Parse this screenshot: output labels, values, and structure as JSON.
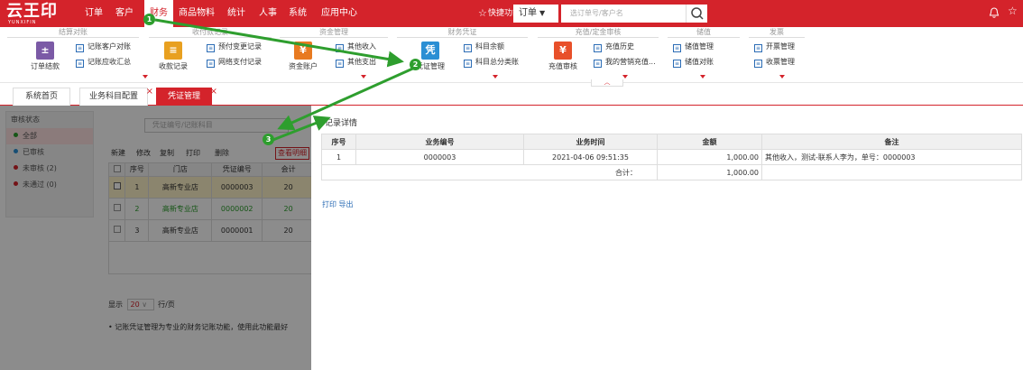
{
  "app": {
    "logo_text": "云王印",
    "logo_sub": "YUNXIFIN",
    "nav": [
      "订单",
      "客户",
      "财务",
      "商品物料",
      "统计",
      "人事",
      "系统",
      "应用中心"
    ],
    "quick": "快捷功能",
    "search_type": "订单",
    "search_placeholder": "选订单号/客户名"
  },
  "ribbon": {
    "groups": [
      "结算对账",
      "收付款记录",
      "资金管理",
      "财务凭证",
      "充值/定金审核",
      "储值",
      "发票"
    ],
    "big": [
      "订单结款",
      "收款记录",
      "资金账户",
      "凭证管理",
      "充值审核"
    ],
    "small": [
      "记账客户对账",
      "记账应收汇总",
      "预付变更记录",
      "网络支付记录",
      "其他收入",
      "其他支出",
      "科目余额",
      "科目总分类账",
      "充值历史",
      "我的营销充值...",
      "储值管理",
      "储值对账",
      "开票管理",
      "收票管理"
    ]
  },
  "tabs": [
    "系统首页",
    "业务科目配置",
    "凭证管理"
  ],
  "left_panel": {
    "title": "审核状态",
    "items": [
      {
        "label": "全部",
        "color": "#2a9d2a"
      },
      {
        "label": "已审核",
        "color": "#2b8fd4"
      },
      {
        "label": "未审核 (2)",
        "color": "#d4232b"
      },
      {
        "label": "未通过 (0)",
        "color": "#d4232b"
      }
    ]
  },
  "grid": {
    "search_placeholder": "凭证编号/记账科目",
    "toolbar": [
      "新建",
      "修改",
      "复制",
      "打印",
      "删除",
      "查看明细"
    ],
    "headers": [
      "序号",
      "门店",
      "凭证编号",
      "会计"
    ],
    "rows": [
      {
        "n": "1",
        "store": "高新专业店",
        "no": "0000003",
        "d": "20"
      },
      {
        "n": "2",
        "store": "高新专业店",
        "no": "0000002",
        "d": "20"
      },
      {
        "n": "3",
        "store": "高新专业店",
        "no": "0000001",
        "d": "20"
      }
    ],
    "pager_show": "显示",
    "pager_size": "20",
    "pager_unit": "行/页",
    "note": "记账凭证管理为专业的财务记账功能，使用此功能最好"
  },
  "dialog": {
    "title": "记录详情",
    "headers": [
      "序号",
      "业务编号",
      "业务时间",
      "金额",
      "备注"
    ],
    "rows": [
      {
        "n": "1",
        "biz_no": "0000003",
        "time": "2021-04-06 09:51:35",
        "amount": "1,000.00",
        "remark": "其他收入，测试-联系人李为，单号：0000003"
      }
    ],
    "total_label": "合计：",
    "total": "1,000.00",
    "print": "打印",
    "export": "导出"
  },
  "badges": [
    "1",
    "2",
    "3"
  ],
  "colors": {
    "brand": "#d4232b",
    "arrow": "#2e9e2e"
  }
}
